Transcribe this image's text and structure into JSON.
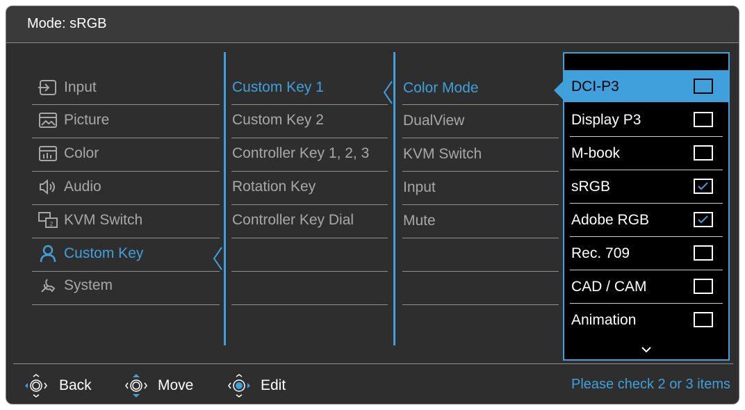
{
  "title": "Mode: sRGB",
  "main_menu": [
    {
      "label": "Input",
      "icon": "input-icon"
    },
    {
      "label": "Picture",
      "icon": "picture-icon"
    },
    {
      "label": "Color",
      "icon": "color-icon"
    },
    {
      "label": "Audio",
      "icon": "audio-icon"
    },
    {
      "label": "KVM Switch",
      "icon": "kvm-switch-icon"
    },
    {
      "label": "Custom Key",
      "icon": "custom-key-icon",
      "active": true
    },
    {
      "label": "System",
      "icon": "system-icon"
    }
  ],
  "custom_key_menu": [
    "Custom Key 1",
    "Custom Key 2",
    "Controller Key 1, 2, 3",
    "Rotation Key",
    "Controller Key Dial"
  ],
  "function_menu": [
    "Color Mode",
    "DualView",
    "KVM Switch",
    "Input",
    "Mute"
  ],
  "color_modes": [
    {
      "label": "DCI-P3",
      "checked": false,
      "selected": true
    },
    {
      "label": "Display P3",
      "checked": false
    },
    {
      "label": "M-book",
      "checked": false
    },
    {
      "label": "sRGB",
      "checked": true
    },
    {
      "label": "Adobe RGB",
      "checked": true
    },
    {
      "label": "Rec. 709",
      "checked": false
    },
    {
      "label": "CAD / CAM",
      "checked": false
    },
    {
      "label": "Animation",
      "checked": false
    }
  ],
  "footer": {
    "back": "Back",
    "move": "Move",
    "edit": "Edit",
    "hint": "Please check 2 or 3 items"
  },
  "colors": {
    "accent": "#3fa0dc",
    "background": "#2e2e2e",
    "panel": "#000000"
  }
}
